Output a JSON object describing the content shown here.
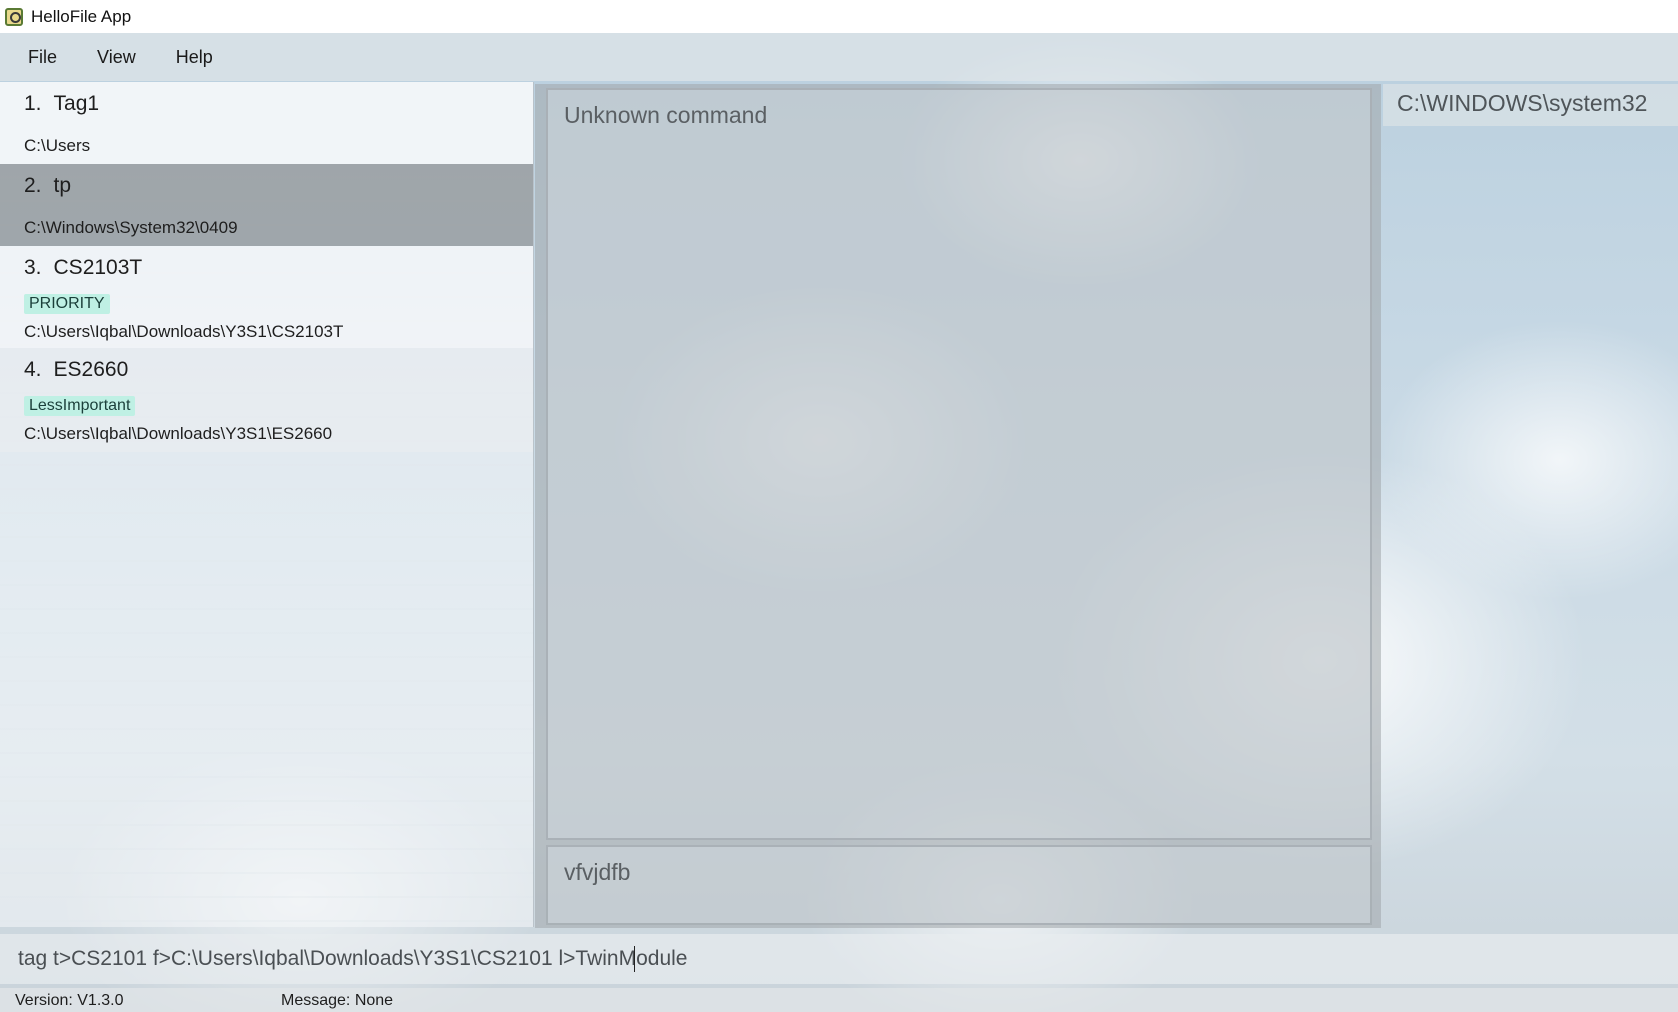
{
  "window": {
    "title": "HelloFile App"
  },
  "menu": {
    "items": [
      "File",
      "View",
      "Help"
    ]
  },
  "list": {
    "items": [
      {
        "index": "1.",
        "name": "Tag1",
        "tags": [],
        "path": "C:\\Users",
        "selected": false
      },
      {
        "index": "2.",
        "name": "tp",
        "tags": [],
        "path": "C:\\Windows\\System32\\0409",
        "selected": true
      },
      {
        "index": "3.",
        "name": "CS2103T",
        "tags": [
          "PRIORITY"
        ],
        "path": "C:\\Users\\Iqbal\\Downloads\\Y3S1\\CS2103T",
        "selected": false
      },
      {
        "index": "4.",
        "name": "ES2660",
        "tags": [
          "LessImportant"
        ],
        "path": "C:\\Users\\Iqbal\\Downloads\\Y3S1\\ES2660",
        "selected": false
      }
    ]
  },
  "result": {
    "text": "Unknown command"
  },
  "feedback": {
    "text": "vfvjdfb"
  },
  "directory": {
    "current": "C:\\WINDOWS\\system32"
  },
  "command": {
    "value": "tag t>CS2101 f>C:\\Users\\Iqbal\\Downloads\\Y3S1\\CS2101 l>TwinModule"
  },
  "status": {
    "version": "Version:  V1.3.0",
    "message": "Message:  None"
  },
  "colors": {
    "tag_background": "#bff0e4",
    "selected_row": "#878c90"
  },
  "icons": {
    "app": "magnifier-app-icon"
  }
}
